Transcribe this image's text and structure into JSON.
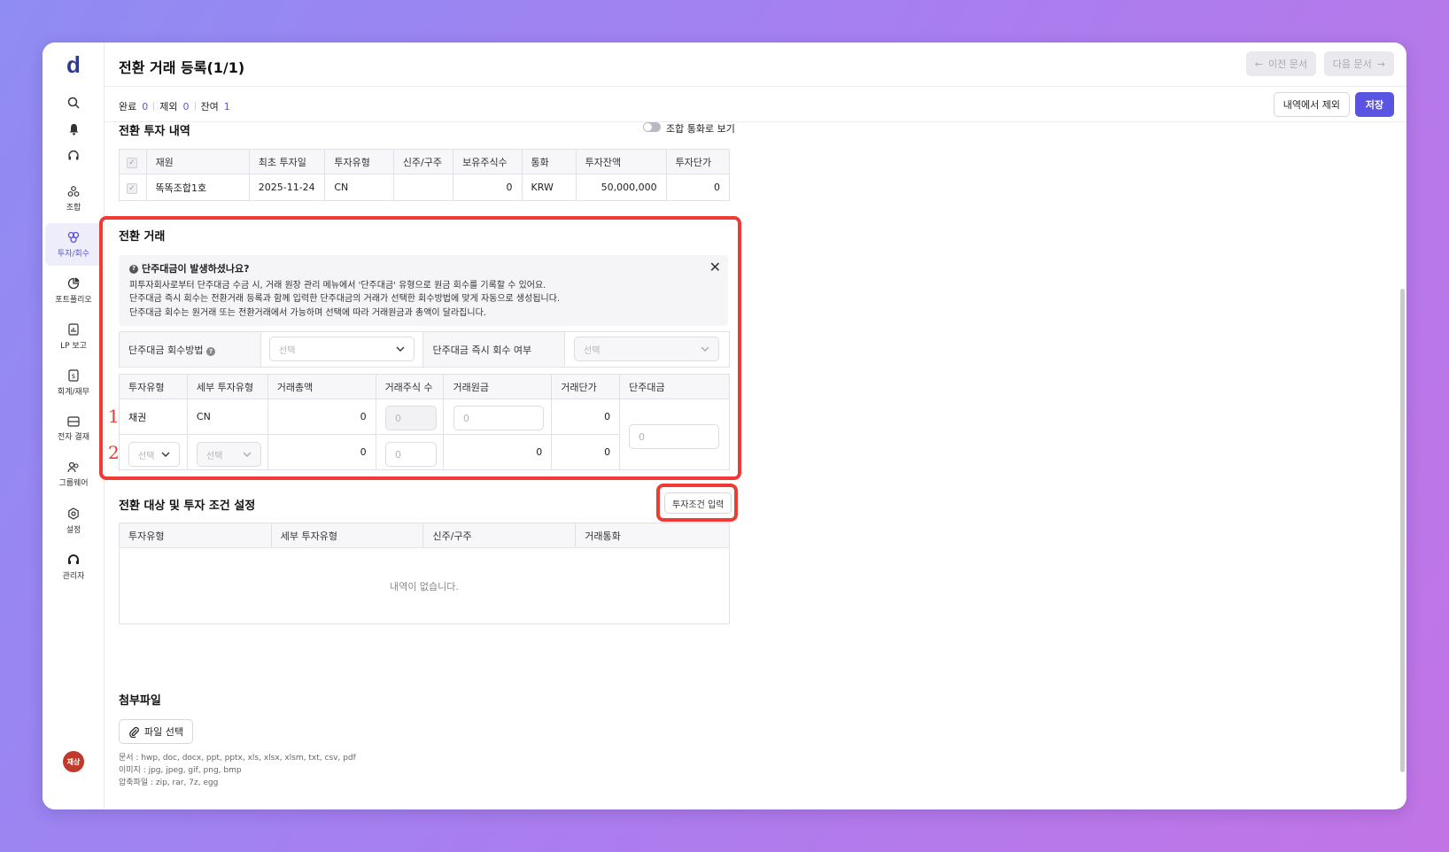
{
  "sidebar": {
    "logo": "d",
    "items": [
      {
        "label": "조합",
        "icon": "fund-icon"
      },
      {
        "label": "투자/회수",
        "icon": "investment-icon"
      },
      {
        "label": "포트폴리오",
        "icon": "portfolio-icon"
      },
      {
        "label": "LP 보고",
        "icon": "report-icon"
      },
      {
        "label": "회계/재무",
        "icon": "accounting-icon"
      },
      {
        "label": "전자 결재",
        "icon": "approval-icon"
      },
      {
        "label": "그룹웨어",
        "icon": "groupware-icon"
      },
      {
        "label": "설정",
        "icon": "gear-icon"
      },
      {
        "label": "관리자",
        "icon": "admin-icon"
      }
    ],
    "avatar": "재상"
  },
  "header": {
    "title": "전환 거래 등록(1/1)",
    "prev_label": "이전 문서",
    "next_label": "다음 문서"
  },
  "status": {
    "done_label": "완료",
    "done_count": "0",
    "excluded_label": "제외",
    "excluded_count": "0",
    "remaining_label": "잔여",
    "remaining_count": "1"
  },
  "actions": {
    "exclude_label": "내역에서 제외",
    "save_label": "저장"
  },
  "investment_history": {
    "title": "전환 투자 내역",
    "toggle_label": "조합 통화로 보기",
    "columns": [
      "재원",
      "최초 투자일",
      "투자유형",
      "신주/구주",
      "보유주식수",
      "통화",
      "투자잔액",
      "투자단가"
    ],
    "rows": [
      [
        "똑똑조합1호",
        "2025-11-24",
        "CN",
        "",
        "0",
        "KRW",
        "50,000,000",
        "0"
      ]
    ]
  },
  "conversion": {
    "title": "전환 거래",
    "notice_title": "단주대금이 발생하셨나요?",
    "notice_lines": [
      "피투자회사로부터 단주대금 수금 시, 거래 원장 관리 메뉴에서 '단주대금' 유형으로 원금 회수를 기록할 수 있어요.",
      "단주대금 즉시 회수는 전환거래 등록과 함께 입력한 단주대금의 거래가 선택한 회수방법에 맞게 자동으로 생성됩니다.",
      "단주대금 회수는 원거래 또는 전환거래에서 가능하며 선택에 따라 거래원금과 총액이 달라집니다."
    ],
    "method_label": "단주대금 회수방법",
    "method_placeholder": "선택",
    "immediate_label": "단주대금 즉시 회수 여부",
    "immediate_placeholder": "선택",
    "columns": [
      "투자유형",
      "세부 투자유형",
      "거래총액",
      "거래주식 수",
      "거래원금",
      "거래단가",
      "단주대금"
    ],
    "row1": {
      "type": "채권",
      "subtype": "CN",
      "total": "0",
      "shares_placeholder": "0",
      "principal_placeholder": "0",
      "unit_price": "0"
    },
    "row2": {
      "type_placeholder": "선택",
      "subtype_placeholder": "선택",
      "total": "0",
      "shares_placeholder": "0",
      "principal": "0",
      "unit_price": "0"
    },
    "fractional_placeholder": "0",
    "row_marker_1": "1",
    "row_marker_2": "2"
  },
  "targets": {
    "title": "전환 대상 및 투자 조건 설정",
    "input_button": "투자조건 입력",
    "columns": [
      "투자유형",
      "세부 투자유형",
      "신주/구주",
      "거래통화"
    ],
    "empty_text": "내역이 없습니다."
  },
  "attachments": {
    "title": "첨부파일",
    "button": "파일 선택",
    "formats": [
      "문서 : hwp, doc, docx, ppt, pptx, xls, xlsx, xlsm, txt, csv, pdf",
      "이미지 : jpg, jpeg, gif, png, bmp",
      "압축파일 : zip, rar, 7z, egg"
    ]
  },
  "colors": {
    "accent": "#5a55e0",
    "highlight": "#ef3b33"
  }
}
